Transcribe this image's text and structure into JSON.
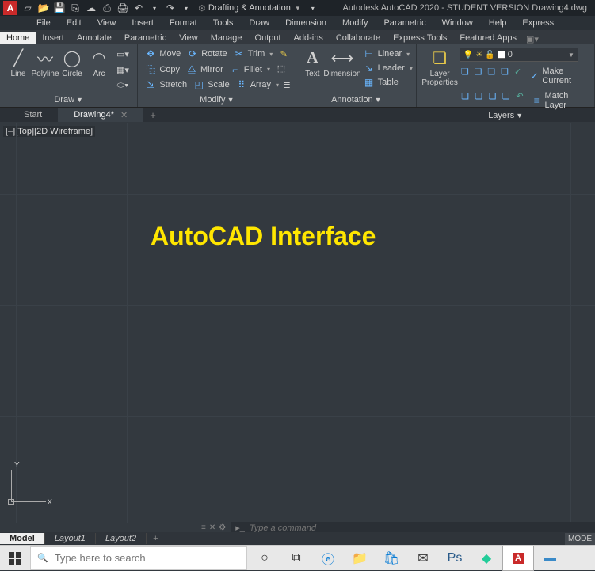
{
  "title_bar": {
    "app_letter": "A",
    "workspace": "Drafting & Annotation",
    "title": "Autodesk AutoCAD 2020 - STUDENT VERSION   Drawing4.dwg"
  },
  "menu": [
    "File",
    "Edit",
    "View",
    "Insert",
    "Format",
    "Tools",
    "Draw",
    "Dimension",
    "Modify",
    "Parametric",
    "Window",
    "Help",
    "Express"
  ],
  "ribbon_tabs": [
    "Home",
    "Insert",
    "Annotate",
    "Parametric",
    "View",
    "Manage",
    "Output",
    "Add-ins",
    "Collaborate",
    "Express Tools",
    "Featured Apps"
  ],
  "ribbon_active": "Home",
  "panels": {
    "draw": {
      "title": "Draw",
      "tools": {
        "line": "Line",
        "polyline": "Polyline",
        "circle": "Circle",
        "arc": "Arc"
      }
    },
    "modify": {
      "title": "Modify",
      "rows": [
        {
          "a": "Move",
          "b": "Rotate",
          "c": "Trim"
        },
        {
          "a": "Copy",
          "b": "Mirror",
          "c": "Fillet"
        },
        {
          "a": "Stretch",
          "b": "Scale",
          "c": "Array"
        }
      ]
    },
    "annotation": {
      "title": "Annotation",
      "text": "Text",
      "dimension": "Dimension",
      "linear": "Linear",
      "leader": "Leader",
      "table": "Table"
    },
    "layers": {
      "title": "Layers",
      "properties": "Layer\nProperties",
      "current_layer": "0",
      "make_current": "Make Current",
      "match_layer": "Match Layer"
    }
  },
  "doc_tabs": {
    "start": "Start",
    "active": "Drawing4*"
  },
  "view_label": "[–][Top][2D Wireframe]",
  "canvas_text": "AutoCAD Interface",
  "ucs": {
    "y": "Y",
    "x": "X"
  },
  "command": {
    "placeholder": "Type a command"
  },
  "layout_tabs": {
    "model": "Model",
    "l1": "Layout1",
    "l2": "Layout2"
  },
  "mode_indicator": "MODE",
  "taskbar": {
    "search_placeholder": "Type here to search"
  }
}
